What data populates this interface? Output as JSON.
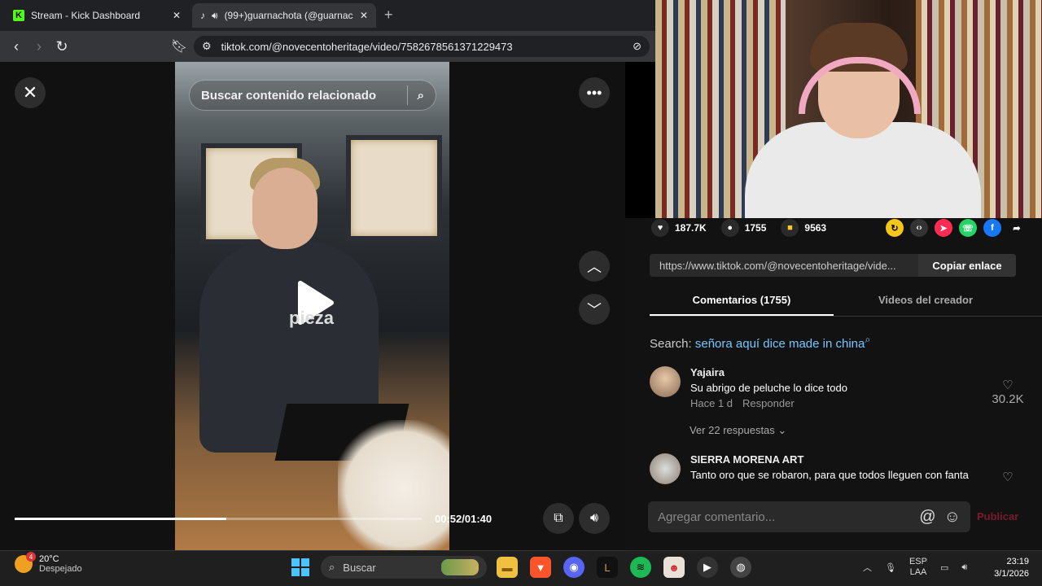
{
  "browser": {
    "tabs": [
      {
        "title": "Stream - Kick Dashboard",
        "favicon": "kick-icon"
      },
      {
        "title": "(99+)guarnachota (@guarnac",
        "favicon": "tiktok-icon",
        "audio": true
      }
    ],
    "new_tab_symbol": "+",
    "url": "tiktok.com/@novecentoheritage/video/7582678561371229473"
  },
  "video": {
    "search_placeholder": "Buscar contenido relacionado",
    "caption_overlay": "pieza",
    "timestamp": "00:52/01:40",
    "progress_fraction": 0.52
  },
  "actions": {
    "likes": "187.7K",
    "comments": "1755",
    "saves": "9563"
  },
  "share": {
    "link": "https://www.tiktok.com/@novecentoheritage/vide...",
    "copy_label": "Copiar enlace"
  },
  "panel": {
    "tabs": [
      "Comentarios (1755)",
      "Videos del creador"
    ],
    "search_label": "Search:",
    "search_query": "señora aquí dice made in china"
  },
  "comments": [
    {
      "user": "Yajaira",
      "text": "Su abrigo de peluche lo dice todo",
      "time": "Hace 1 d",
      "reply_label": "Responder",
      "likes": "30.2K",
      "view_replies": "Ver 22 respuestas"
    },
    {
      "user": "SIERRA MORENA ART",
      "text": "Tanto oro que se robaron, para que todos lleguen con fanta"
    }
  ],
  "comment_input": {
    "placeholder": "Agregar comentario...",
    "publish_label": "Publicar"
  },
  "taskbar": {
    "weather_temp": "20°C",
    "weather_desc": "Despejado",
    "weather_badge": "4",
    "search_placeholder": "Buscar",
    "lang": "ESP",
    "lang_sub": "LAA",
    "time": "23:19",
    "date": "3/1/2026"
  },
  "colors": {
    "kick_green": "#53fc18",
    "tiktok_save_yellow": "#facc15",
    "link_blue": "#76c6ff",
    "publish_red": "#7b1a2c"
  }
}
